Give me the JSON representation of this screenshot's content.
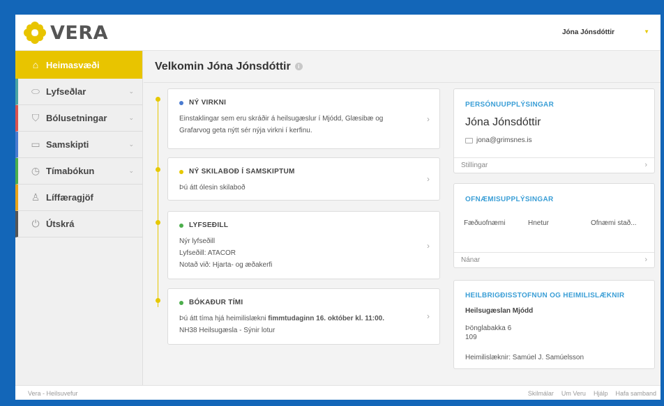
{
  "app": {
    "name": "VERA"
  },
  "header": {
    "user_name": "Jóna Jónsdóttir"
  },
  "sidebar": {
    "items": [
      {
        "label": "Heimasvæði",
        "icon": "home-icon",
        "accent": "#e8c400"
      },
      {
        "label": "Lyfseðlar",
        "icon": "pill-icon",
        "accent": "#4aa3a3"
      },
      {
        "label": "Bólusetningar",
        "icon": "shield-icon",
        "accent": "#d9534f"
      },
      {
        "label": "Samskipti",
        "icon": "chat-icon",
        "accent": "#4a7bd0"
      },
      {
        "label": "Tímabókun",
        "icon": "clock-icon",
        "accent": "#4cae4c"
      },
      {
        "label": "Líffæragjöf",
        "icon": "person-icon",
        "accent": "#e8a317"
      },
      {
        "label": "Útskrá",
        "icon": "power-icon",
        "accent": "#555555"
      }
    ]
  },
  "main": {
    "title": "Velkomin Jóna Jónsdóttir"
  },
  "cards": [
    {
      "heading": "NÝ VIRKNI",
      "dot_color": "#4a7bd0",
      "body": "Einstaklingar sem eru skráðir á heilsugæslur í Mjódd, Glæsibæ og Grafarvog geta nýtt sér nýja virkni í kerfinu."
    },
    {
      "heading": "NÝ SKILABOÐ Í SAMSKIPTUM",
      "dot_color": "#e6c800",
      "body": "Þú átt ólesin skilaboð"
    },
    {
      "heading": "LYFSEÐILL",
      "dot_color": "#4cae4c",
      "line1": "Nýr lyfseðill",
      "line2": "Lyfseðill: ATACOR",
      "line3": "Notað við: Hjarta- og æðakerfi"
    },
    {
      "heading": "BÓKAÐUR TÍMI",
      "dot_color": "#4cae4c",
      "line1_pre": "Þú átt tíma hjá heimilislækni ",
      "line1_bold": "fimmtudaginn 16. október kl. 11:00.",
      "line2": "NH38 Heilsugæsla - Sýnir lotur"
    }
  ],
  "personal": {
    "title": "PERSÓNUUPPLÝSINGAR",
    "name": "Jóna Jónsdóttir",
    "email": "jona@grimsnes.is",
    "footer": "Stillingar"
  },
  "allergy": {
    "title": "OFNÆMISUPPLÝSINGAR",
    "col1": "Fæðuofnæmi",
    "col2": "Hnetur",
    "col3": "Ofnæmi stað...",
    "footer": "Nánar"
  },
  "clinic": {
    "title": "HEILBRIGÐISSTOFNUN OG HEIMILISLÆKNIR",
    "name": "Heilsugæslan Mjódd",
    "address1": "Þönglabakka 6",
    "address2": "109",
    "doctor": "Heimilislæknir: Samúel J. Samúelsson"
  },
  "footer": {
    "left": "Vera - Heilsuvefur",
    "links": [
      "Skilmálar",
      "Um Veru",
      "Hjálp",
      "Hafa samband"
    ]
  }
}
